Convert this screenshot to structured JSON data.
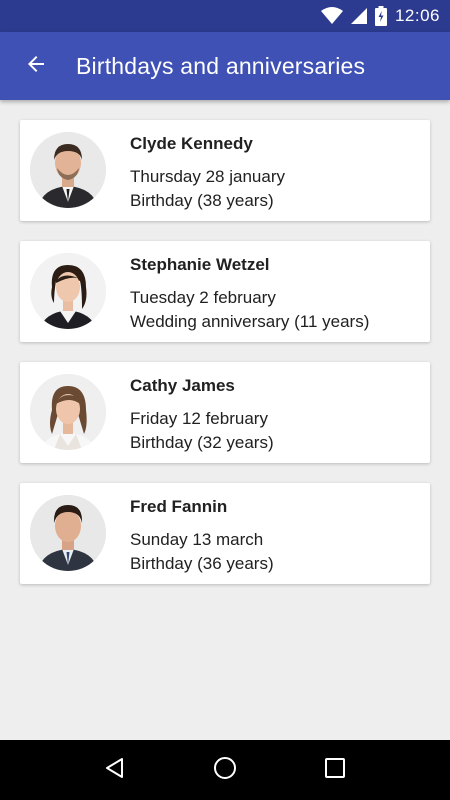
{
  "status_bar": {
    "time": "12:06",
    "icons": [
      "wifi-icon",
      "cell-signal-icon",
      "battery-icon"
    ]
  },
  "app_bar": {
    "title": "Birthdays and anniversaries",
    "back_icon": "arrow-back-icon",
    "color": "#3f51b5",
    "status_color": "#2c3a8f"
  },
  "items": [
    {
      "name": "Clyde Kennedy",
      "date": "Thursday 28 january",
      "event": "Birthday (38 years)"
    },
    {
      "name": "Stephanie Wetzel",
      "date": "Tuesday 2 february",
      "event": "Wedding anniversary (11 years)"
    },
    {
      "name": "Cathy James",
      "date": "Friday 12 february",
      "event": "Birthday (32 years)"
    },
    {
      "name": "Fred Fannin",
      "date": "Sunday 13 march",
      "event": "Birthday (36 years)"
    }
  ],
  "nav_bar": {
    "icons": [
      "back-triangle-icon",
      "home-circle-icon",
      "recents-square-icon"
    ]
  }
}
